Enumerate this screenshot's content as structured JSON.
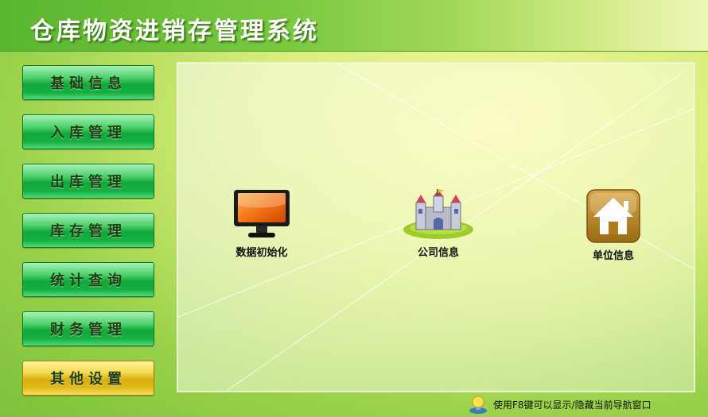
{
  "header": {
    "title": "仓库物资进销存管理系统"
  },
  "sidebar": {
    "items": [
      {
        "label": "基础信息"
      },
      {
        "label": "入库管理"
      },
      {
        "label": "出库管理"
      },
      {
        "label": "库存管理"
      },
      {
        "label": "统计查询"
      },
      {
        "label": "财务管理"
      },
      {
        "label": "其他设置"
      }
    ],
    "active_index": 6
  },
  "main": {
    "tiles": [
      {
        "label": "数据初始化",
        "icon": "monitor-icon"
      },
      {
        "label": "公司信息",
        "icon": "castle-icon"
      },
      {
        "label": "单位信息",
        "icon": "house-icon"
      }
    ]
  },
  "status": {
    "hint": "使用F8键可以显示/隐藏当前导航窗口",
    "icon": "user-lightbulb-icon"
  },
  "colors": {
    "nav_green": "#12a83a",
    "nav_active_gold": "#d9ad12",
    "title_text": "#ffffff"
  }
}
